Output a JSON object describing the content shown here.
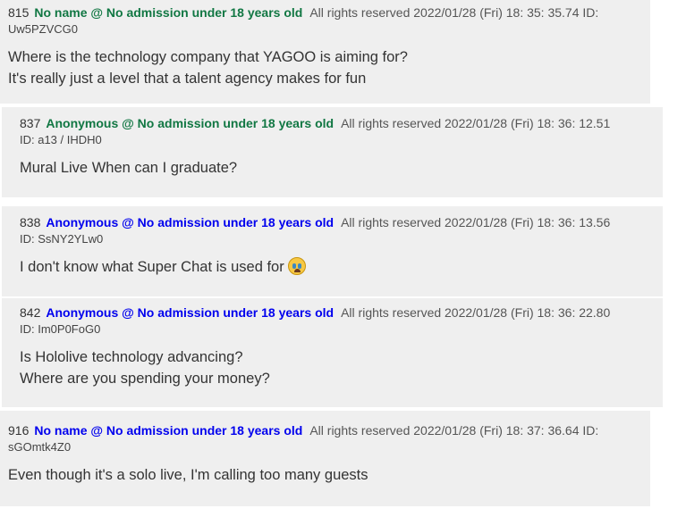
{
  "posts": [
    {
      "number": "815",
      "name": "No name @ No admission under 18 years old",
      "meta": "All rights reserved 2022/01/28 (Fri) 18: 35: 35.74  ID:",
      "id": "Uw5PZVCG0",
      "lines": [
        "Where is the technology company that YAGOO is aiming for?",
        "It's really just a level that a talent agency makes for fun"
      ]
    },
    {
      "number": "837",
      "name": "Anonymous @ No admission under 18 years old",
      "meta": "All rights reserved 2022/01/28 (Fri) 18: 36: 12.51",
      "id": "ID: a13 / IHDH0",
      "lines": [
        "Mural Live When can I graduate?"
      ]
    },
    {
      "number": "838",
      "name": "Anonymous @ No admission under 18 years old",
      "meta": "All rights reserved 2022/01/28 (Fri) 18: 36: 13.56",
      "id": "ID: SsNY2YLw0",
      "lines": [
        "I don't know what Super Chat is used for"
      ],
      "emoji": "crying-face-icon"
    },
    {
      "number": "842",
      "name": "Anonymous @ No admission under 18 years old",
      "meta": "All rights reserved 2022/01/28 (Fri) 18: 36: 22.80",
      "id": "ID: Im0P0FoG0",
      "lines": [
        "Is Hololive technology advancing?",
        "Where are you spending your money?"
      ]
    },
    {
      "number": "916",
      "name": "No name @ No admission under 18 years old",
      "meta": "All rights reserved 2022/01/28 (Fri) 18: 37: 36.64  ID:",
      "id": "sGOmtk4Z0",
      "lines": [
        "Even though it's a solo live, I'm calling too many guests"
      ]
    }
  ],
  "colors": {
    "post_bg": "#efefef",
    "name_green": "#117743",
    "name_blue": "#0000ee"
  }
}
